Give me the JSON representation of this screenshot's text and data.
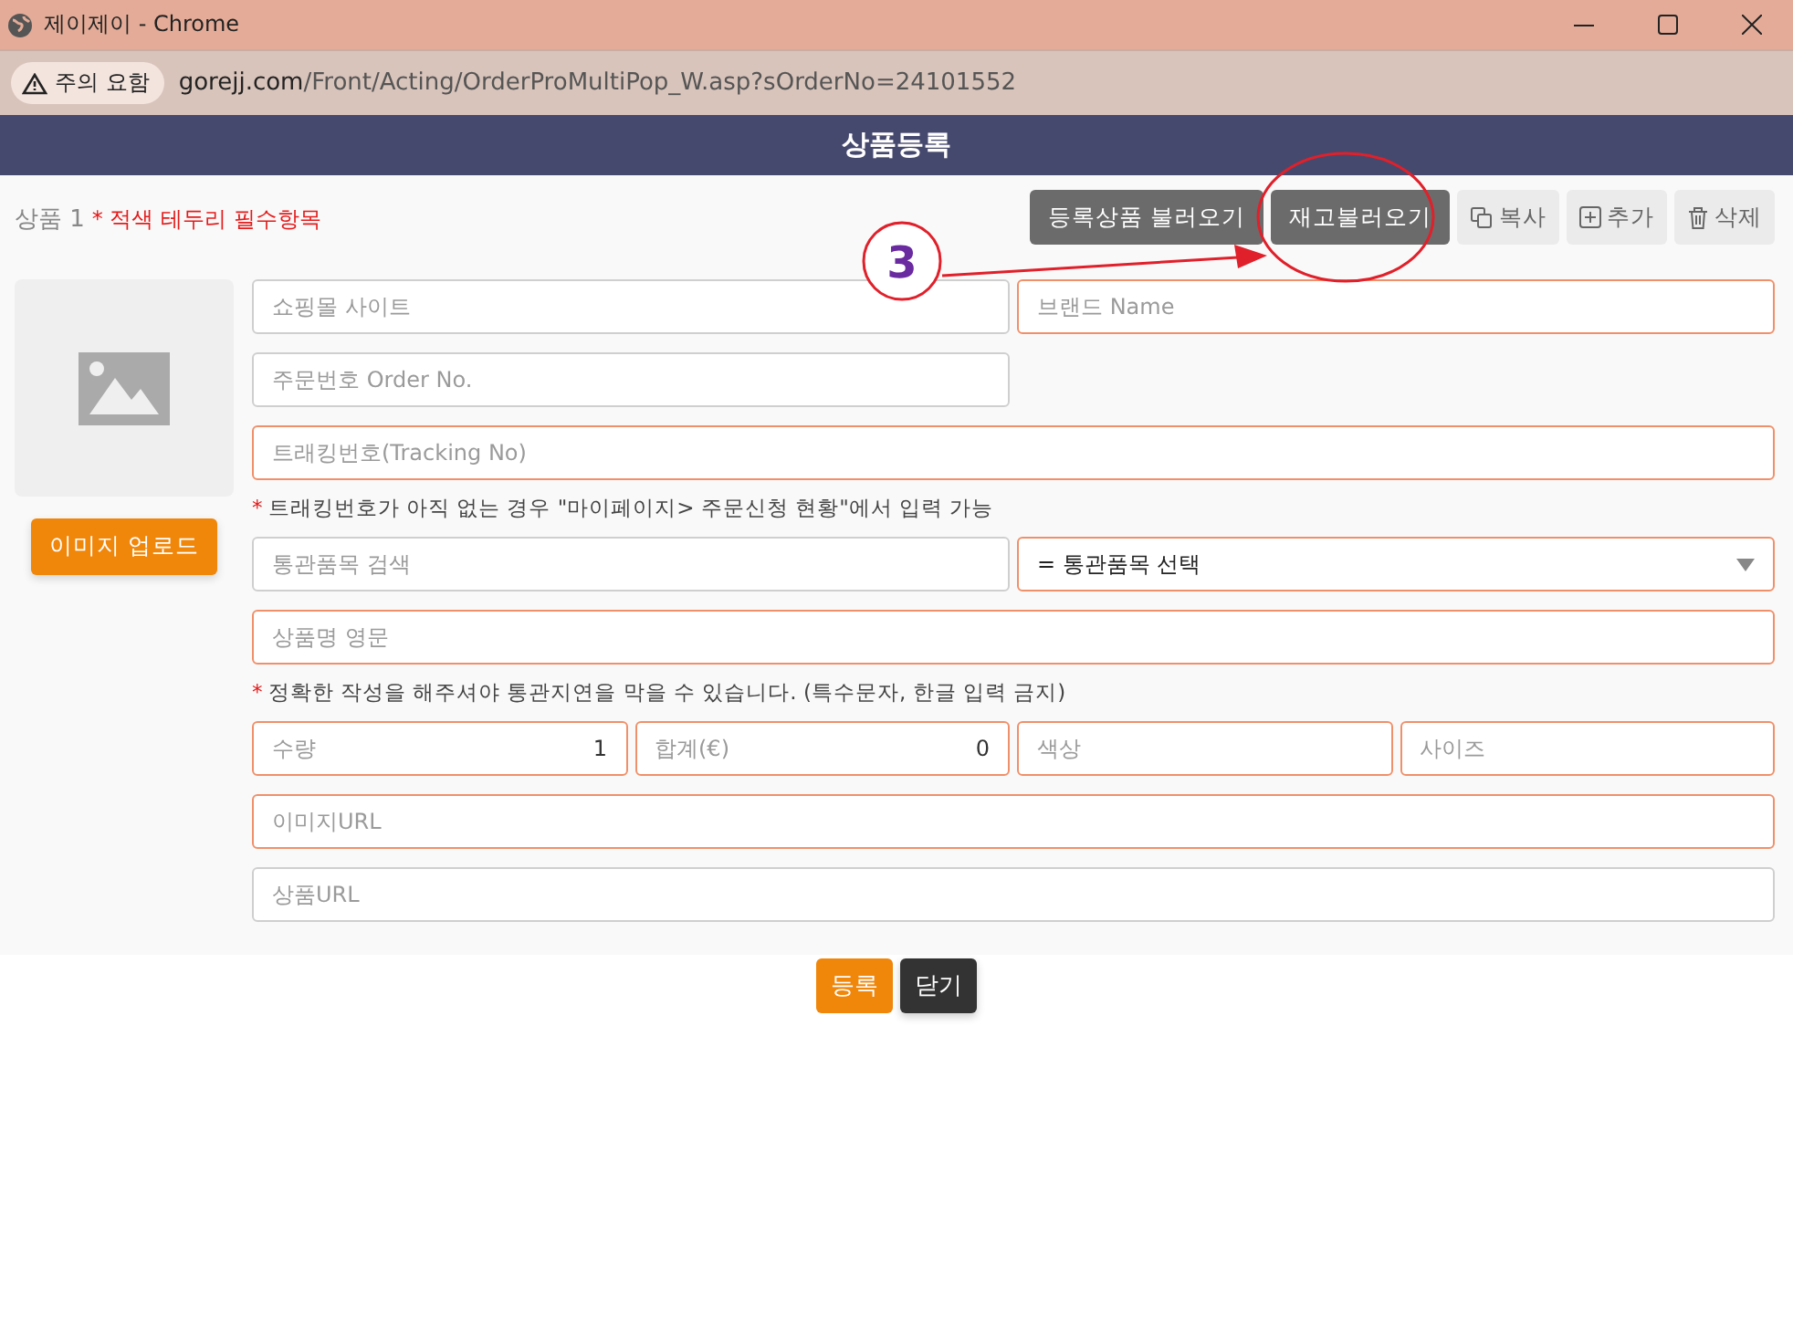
{
  "window": {
    "title": "제이제이 - Chrome"
  },
  "address_bar": {
    "security_badge": "주의 요함",
    "url_host": "gorejj.com",
    "url_path": "/Front/Acting/OrderProMultiPop_W.asp?sOrderNo=24101552"
  },
  "header": {
    "title": "상품등록"
  },
  "product": {
    "label": "상품 1",
    "required_note": "* 적색 테두리 필수항목"
  },
  "toolbar": [
    {
      "kind": "dark",
      "label": "등록상품 불러오기"
    },
    {
      "kind": "dark",
      "label": "재고불러오기"
    },
    {
      "kind": "copy",
      "label": "복사"
    },
    {
      "kind": "add",
      "label": "추가"
    },
    {
      "kind": "delete",
      "label": "삭제"
    }
  ],
  "image_upload": {
    "label": "이미지 업로드"
  },
  "form_rows": [
    {
      "kind": "half",
      "fields": [
        {
          "kind": "input",
          "placeholder": "쇼핑몰 사이트",
          "required": false
        },
        {
          "kind": "input",
          "placeholder": "브랜드 Name",
          "required": true
        }
      ]
    },
    {
      "kind": "half",
      "fields": [
        {
          "kind": "input",
          "placeholder": "주문번호 Order No.",
          "required": false
        }
      ]
    },
    {
      "kind": "full",
      "fields": [
        {
          "kind": "input",
          "placeholder": "트래킹번호(Tracking No)",
          "required": true
        }
      ]
    },
    {
      "kind": "note",
      "mark": "*",
      "text": "트래킹번호가 아직 없는 경우 \"마이페이지> 주문신청 현황\"에서 입력 가능"
    },
    {
      "kind": "half",
      "fields": [
        {
          "kind": "input",
          "placeholder": "통관품목 검색",
          "required": false
        },
        {
          "kind": "select",
          "value": "= 통관품목 선택",
          "required": true
        }
      ]
    },
    {
      "kind": "full",
      "fields": [
        {
          "kind": "input",
          "placeholder": "상품명 영문",
          "required": true
        }
      ]
    },
    {
      "kind": "note",
      "mark": "*",
      "text": "정확한 작성을 해주셔야 통관지연을 막을 수 있습니다. (특수문자, 한글 입력 금지)"
    },
    {
      "kind": "quarter",
      "fields": [
        {
          "kind": "labeled",
          "label": "수량",
          "value": "1",
          "required": true
        },
        {
          "kind": "labeled",
          "label": "합계(€)",
          "value": "0",
          "required": true
        },
        {
          "kind": "input",
          "placeholder": "색상",
          "required": true
        },
        {
          "kind": "input",
          "placeholder": "사이즈",
          "required": true
        }
      ]
    },
    {
      "kind": "full",
      "fields": [
        {
          "kind": "input",
          "placeholder": "이미지URL",
          "required": true
        }
      ]
    },
    {
      "kind": "full",
      "fields": [
        {
          "kind": "input",
          "placeholder": "상품URL",
          "required": false
        }
      ]
    }
  ],
  "footer_buttons": [
    {
      "kind": "primary",
      "label": "등록"
    },
    {
      "kind": "dark",
      "label": "닫기"
    }
  ],
  "annotation": {
    "step": "3"
  }
}
